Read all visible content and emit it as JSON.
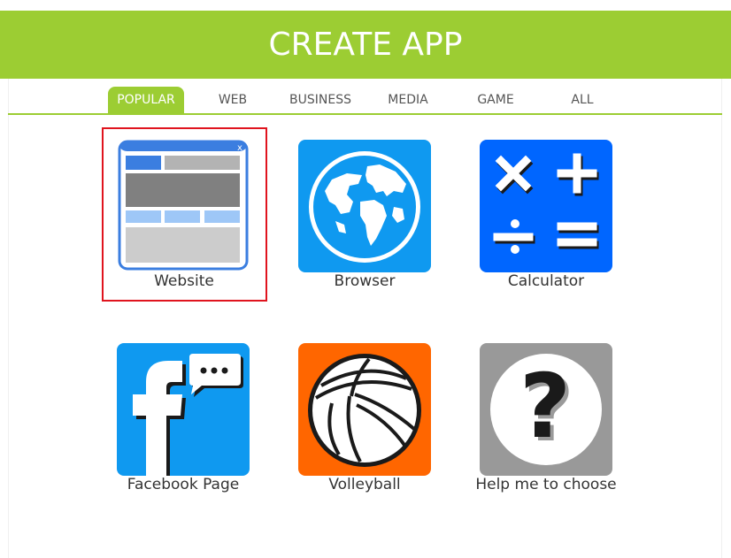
{
  "header": {
    "title": "CREATE APP"
  },
  "tabs": [
    {
      "label": "POPULAR",
      "active": true
    },
    {
      "label": "WEB",
      "active": false
    },
    {
      "label": "BUSINESS",
      "active": false
    },
    {
      "label": "MEDIA",
      "active": false
    },
    {
      "label": "GAME",
      "active": false
    },
    {
      "label": "ALL",
      "active": false
    }
  ],
  "apps": [
    {
      "label": "Website",
      "icon": "website-layout-icon",
      "selected": true
    },
    {
      "label": "Browser",
      "icon": "globe-icon",
      "selected": false
    },
    {
      "label": "Calculator",
      "icon": "calculator-icon",
      "selected": false
    },
    {
      "label": "Facebook Page",
      "icon": "facebook-icon",
      "selected": false
    },
    {
      "label": "Volleyball",
      "icon": "volleyball-icon",
      "selected": false
    },
    {
      "label": "Help me to choose",
      "icon": "question-mark-icon",
      "selected": false
    }
  ],
  "colors": {
    "accent": "#9ccd33",
    "selection": "#e0141e",
    "blue": "#0f99f0",
    "calculator_blue": "#0066ff",
    "orange": "#ff6600",
    "gray": "#999999"
  }
}
